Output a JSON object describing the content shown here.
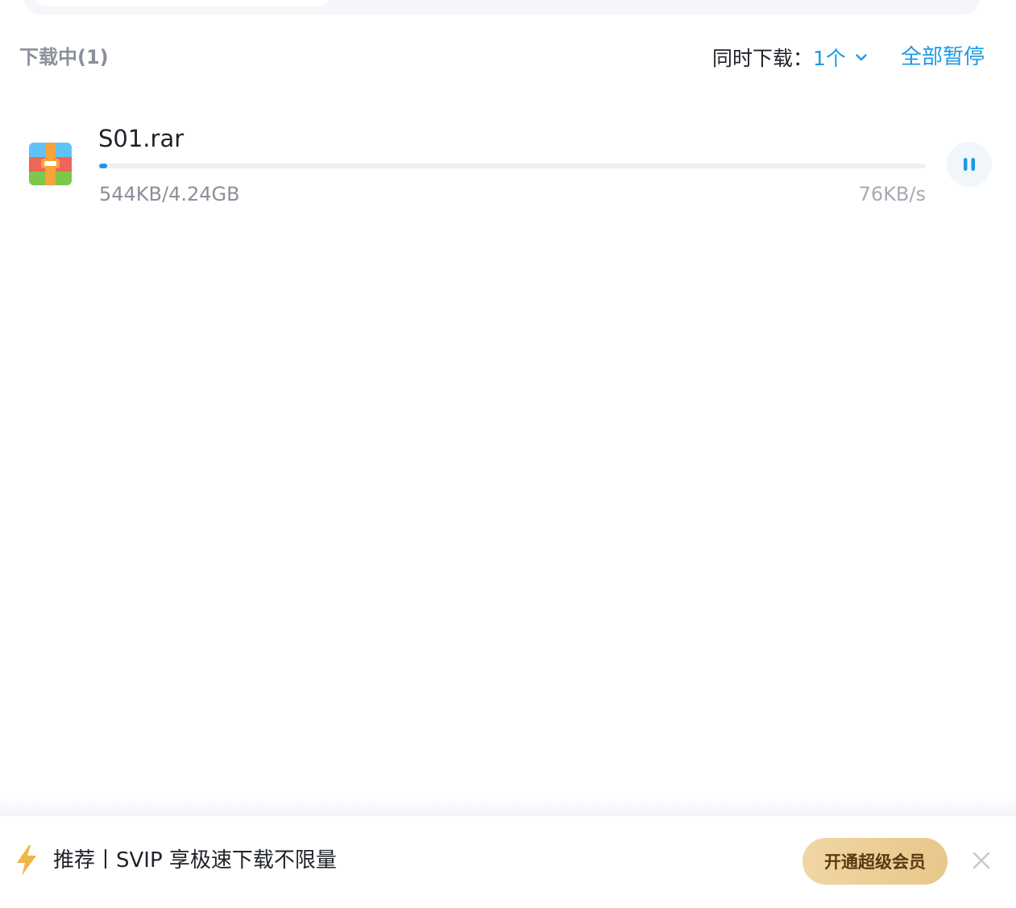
{
  "section": {
    "title": "下载中(1)"
  },
  "concurrency": {
    "label": "同时下载：",
    "value": "1个"
  },
  "actions": {
    "pause_all": "全部暂停"
  },
  "download": {
    "file_name": "S01.rar",
    "size_progress": "544KB/4.24GB",
    "speed": "76KB/s",
    "progress_fraction": 0.0001
  },
  "promo": {
    "text": "推荐丨SVIP 享极速下载不限量",
    "button_label": "开通超级会员"
  },
  "colors": {
    "accent": "#1a9ae6",
    "promo_button": "#eccf96"
  },
  "icons": {
    "file": "archive-file-icon",
    "pause": "pause-icon",
    "dropdown": "chevron-down-icon",
    "promo": "lightning-bolt-icon",
    "close": "close-icon"
  }
}
